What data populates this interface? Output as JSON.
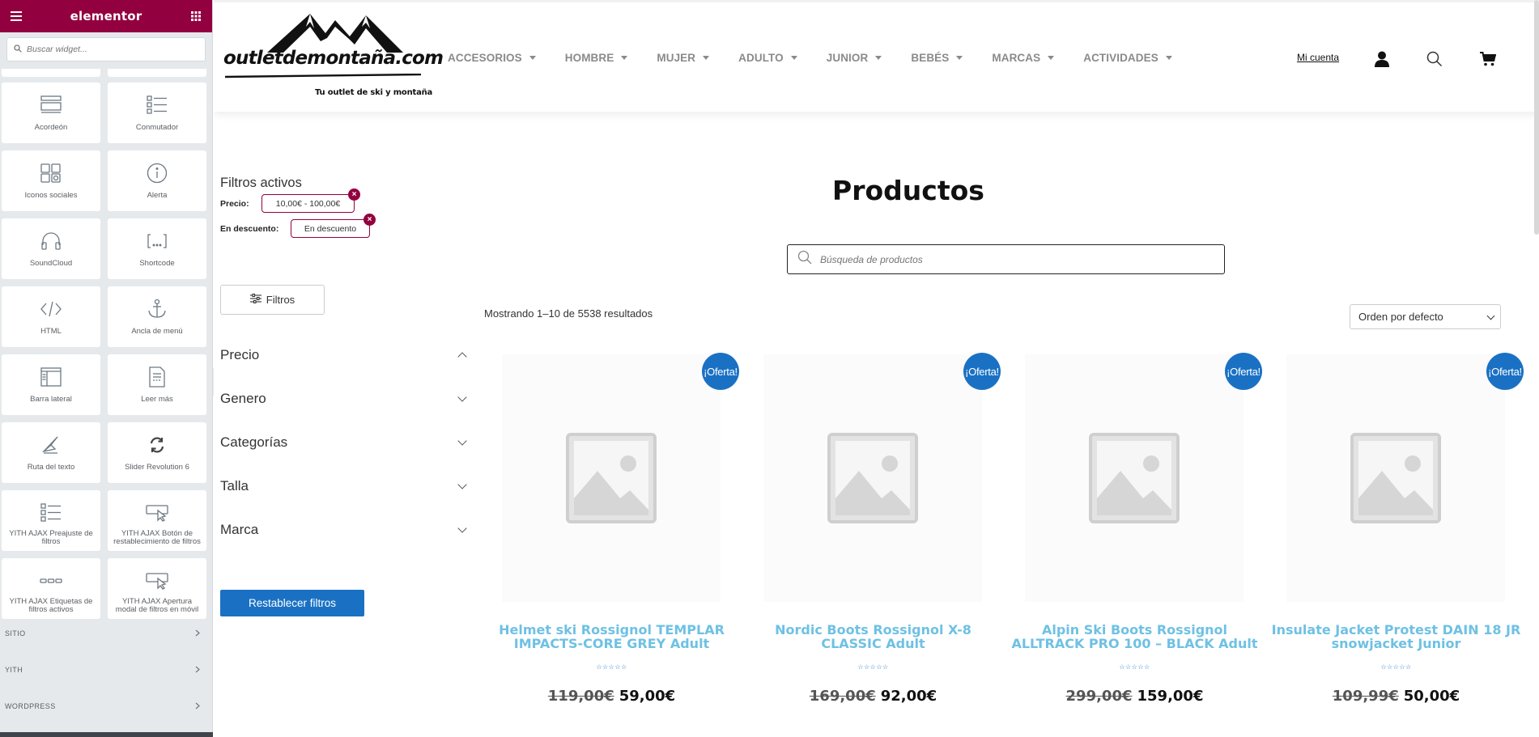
{
  "elementor": {
    "logo": "elementor",
    "search_placeholder": "Buscar widget...",
    "widgets": [
      {
        "label": "Acordeón",
        "icon": "accordion-icon"
      },
      {
        "label": "Conmutador",
        "icon": "toggle-list-icon"
      },
      {
        "label": "Iconos sociales",
        "icon": "social-icons-icon"
      },
      {
        "label": "Alerta",
        "icon": "alert-info-icon"
      },
      {
        "label": "SoundCloud",
        "icon": "headphones-icon"
      },
      {
        "label": "Shortcode",
        "icon": "shortcode-brackets-icon"
      },
      {
        "label": "HTML",
        "icon": "code-icon"
      },
      {
        "label": "Ancla de menú",
        "icon": "anchor-icon"
      },
      {
        "label": "Barra lateral",
        "icon": "sidebar-layout-icon"
      },
      {
        "label": "Leer más",
        "icon": "read-more-doc-icon"
      },
      {
        "label": "Ruta del texto",
        "icon": "text-path-icon"
      },
      {
        "label": "Slider Revolution 6",
        "icon": "revolution-refresh-icon"
      },
      {
        "label": "YITH AJAX Preajuste de filtros",
        "icon": "filter-list-icon"
      },
      {
        "label": "YITH AJAX Botón de restablecimiento de filtros",
        "icon": "cursor-button-icon"
      },
      {
        "label": "YITH AJAX Etiquetas de filtros activos",
        "icon": "tags-dots-icon"
      },
      {
        "label": "YITH AJAX Apertura modal de filtros en móvil",
        "icon": "cursor-button-icon"
      }
    ],
    "categories": [
      "SITIO",
      "YITH",
      "WORDPRESS"
    ]
  },
  "site": {
    "logo_wordmark": "outletdemontaña.com",
    "logo_tagline": "Tu outlet de ski y montaña",
    "nav": [
      "ACCESORIOS",
      "HOMBRE",
      "MUJER",
      "ADULTO",
      "JUNIOR",
      "BEBÉS",
      "MARCAS",
      "ACTIVIDADES"
    ],
    "account_link": "Mi cuenta"
  },
  "filters": {
    "active_title": "Filtros activos",
    "active": [
      {
        "label": "Precio:",
        "value": "10,00€ - 100,00€"
      },
      {
        "label": "En descuento:",
        "value": "En descuento"
      }
    ],
    "button_label": "Filtros",
    "facets": [
      "Precio",
      "Genero",
      "Categorías",
      "Talla",
      "Marca"
    ],
    "reset_label": "Restablecer filtros"
  },
  "shop": {
    "title": "Productos",
    "search_placeholder": "Búsqueda de productos",
    "results": "Mostrando 1–10 de 5538 resultados",
    "orderby": "Orden por defecto",
    "sale_badge": "¡Oferta!",
    "products": [
      {
        "title": "Helmet ski Rossignol TEMPLAR IMPACTS-CORE GREY Adult",
        "old_price": "119,00€",
        "price": "59,00€"
      },
      {
        "title": "Nordic Boots Rossignol X-8 CLASSIC Adult",
        "old_price": "169,00€",
        "price": "92,00€"
      },
      {
        "title": "Alpin Ski Boots Rossignol ALLTRACK PRO 100 – BLACK Adult",
        "old_price": "299,00€",
        "price": "159,00€"
      },
      {
        "title": "Insulate Jacket Protest DAIN 18 JR snowjacket Junior",
        "old_price": "109,99€",
        "price": "50,00€"
      }
    ]
  },
  "colors": {
    "elementor_brand": "#93003f",
    "primary_blue": "#1a71c4",
    "product_title": "#6ec1e4"
  }
}
